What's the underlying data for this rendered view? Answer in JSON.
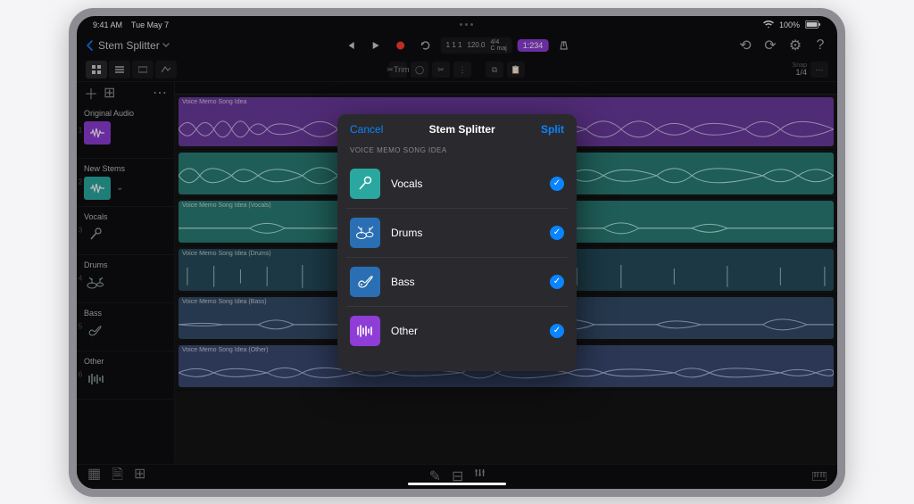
{
  "status": {
    "time": "9:41 AM",
    "date": "Tue May 7",
    "battery": "100%"
  },
  "header": {
    "back_label": "Stem Splitter",
    "transport": {
      "position": "1 1 1",
      "tempo": "120.0",
      "meter": "4/4",
      "key": "C maj",
      "badge": "1:234"
    }
  },
  "toolbar": {
    "trim_label": "Trim",
    "snap_label": "Snap",
    "snap_value": "1/4"
  },
  "sidebar": {
    "tracks": [
      {
        "num": "1",
        "name": "Original Audio",
        "icon_color": "ico-purple",
        "icon": "wave-icon"
      },
      {
        "num": "2",
        "name": "New Stems",
        "icon_color": "ico-teal",
        "icon": "wave-icon",
        "expandable": true
      },
      {
        "num": "3",
        "name": "Vocals",
        "icon_color": "ico-pale",
        "icon": "mic-icon",
        "sub": true
      },
      {
        "num": "4",
        "name": "Drums",
        "icon_color": "ico-pale",
        "icon": "drum-icon",
        "sub": true
      },
      {
        "num": "5",
        "name": "Bass",
        "icon_color": "ico-pale",
        "icon": "guitar-icon",
        "sub": true
      },
      {
        "num": "6",
        "name": "Other",
        "icon_color": "ico-pale",
        "icon": "bars-icon",
        "sub": true
      }
    ]
  },
  "regions": [
    {
      "label": "Voice Memo Song Idea",
      "color": "r-purple"
    },
    {
      "label": "",
      "color": "r-teal"
    },
    {
      "label": "Voice Memo Song Idea (Vocals)",
      "color": "r-teal"
    },
    {
      "label": "Voice Memo Song Idea (Drums)",
      "color": "r-pale-1"
    },
    {
      "label": "Voice Memo Song Idea (Bass)",
      "color": "r-pale-2"
    },
    {
      "label": "Voice Memo Song Idea (Other)",
      "color": "r-pale-3"
    }
  ],
  "modal": {
    "cancel": "Cancel",
    "title": "Stem Splitter",
    "split": "Split",
    "subtitle": "Voice Memo Song Idea",
    "items": [
      {
        "label": "Vocals",
        "icon_color": "ico-teal",
        "checked": true
      },
      {
        "label": "Drums",
        "icon_color": "ico-blue",
        "checked": true
      },
      {
        "label": "Bass",
        "icon_color": "ico-blue",
        "checked": true
      },
      {
        "label": "Other",
        "icon_color": "ico-purple",
        "checked": true
      }
    ]
  },
  "colors": {
    "accent": "#0a84ff",
    "purple": "#8e3dd6",
    "teal": "#2aa8a0",
    "blue": "#2a6fb3"
  }
}
